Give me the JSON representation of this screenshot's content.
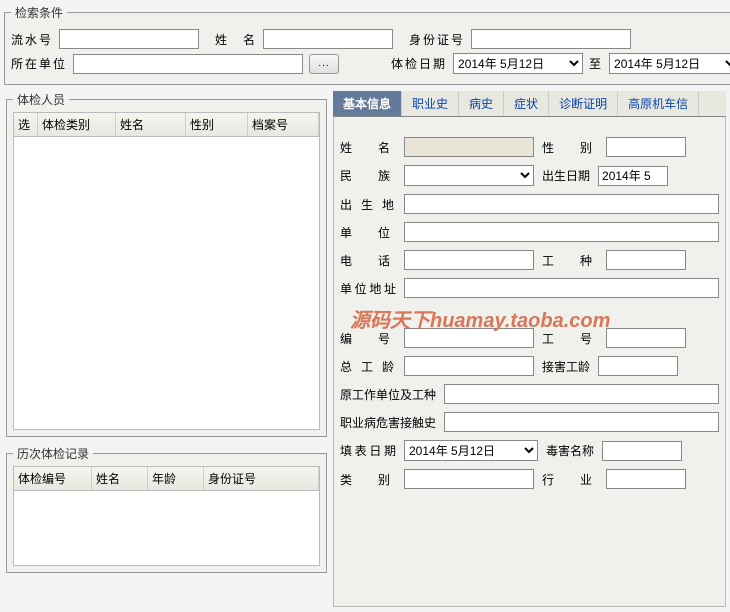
{
  "search": {
    "legend": "检索条件",
    "serial_label": "流水号",
    "serial_value": "",
    "name_label": "姓　名",
    "name_value": "",
    "id_label": "身份证号",
    "id_value": "",
    "unit_label": "所在单位",
    "unit_value": "",
    "date_label": "体检日期",
    "date_from": "2014年 5月12日",
    "date_to_label": "至",
    "date_to": "2014年 5月12日"
  },
  "personnel": {
    "legend": "体检人员",
    "cols": {
      "sel": "选",
      "type": "体检类别",
      "name": "姓名",
      "gender": "性别",
      "fileno": "档案号"
    }
  },
  "history": {
    "legend": "历次体检记录",
    "cols": {
      "examno": "体检编号",
      "name": "姓名",
      "age": "年龄",
      "id": "身份证号"
    }
  },
  "tabs": {
    "basic": "基本信息",
    "career": "职业史",
    "medical": "病史",
    "symptom": "症状",
    "diagnosis": "诊断证明",
    "plateau": "高原机车信"
  },
  "form": {
    "name_label": "姓　名",
    "name_value": "",
    "gender_label": "性　别",
    "gender_value": "",
    "ethnic_label": "民　族",
    "ethnic_value": "",
    "birthdate_label": "出生日期",
    "birthdate_value": "2014年 5",
    "birthplace_label": "出 生 地",
    "birthplace_value": "",
    "unit_label": "单　位",
    "unit_value": "",
    "phone_label": "电　话",
    "phone_value": "",
    "worktype_label": "工　种",
    "worktype_value": "",
    "unitaddr_label": "单位地址",
    "unitaddr_value": "",
    "serial_label": "编　号",
    "serial_value": "",
    "workno_label": "工　号",
    "workno_value": "",
    "totalyears_label": "总 工 龄",
    "totalyears_value": "",
    "hazardyears_label": "接害工龄",
    "hazardyears_value": "",
    "prevwork_label": "原工作单位及工种",
    "prevwork_value": "",
    "hazardhistory_label": "职业病危害接触史",
    "hazardhistory_value": "",
    "formdate_label": "填表日期",
    "formdate_value": "2014年 5月12日",
    "poison_label": "毒害名称",
    "poison_value": "",
    "category_label": "类　别",
    "category_value": "",
    "industry_label": "行　业",
    "industry_value": ""
  },
  "watermark": "源码天下huamay.taoba.com"
}
